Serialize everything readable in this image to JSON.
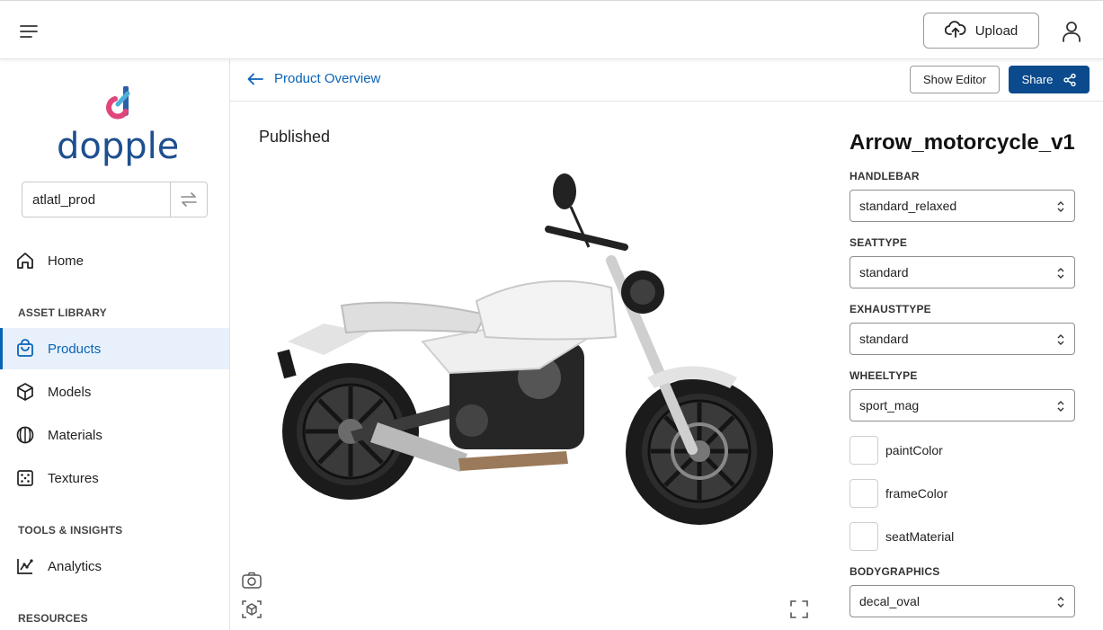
{
  "topbar": {
    "upload_label": "Upload"
  },
  "sidebar": {
    "logo_text": "dopple",
    "workspace": "atlatl_prod",
    "home": "Home",
    "section_asset_library": "ASSET LIBRARY",
    "products": "Products",
    "models": "Models",
    "materials": "Materials",
    "textures": "Textures",
    "section_tools": "TOOLS & INSIGHTS",
    "analytics": "Analytics",
    "section_resources": "RESOURCES"
  },
  "subheader": {
    "back_label": "Product Overview",
    "show_editor_label": "Show Editor",
    "share_label": "Share"
  },
  "viewer": {
    "status": "Published"
  },
  "config": {
    "title": "Arrow_motorcycle_v1",
    "options": [
      {
        "label": "HANDLEBAR",
        "value": "standard_relaxed"
      },
      {
        "label": "SEATTYPE",
        "value": "standard"
      },
      {
        "label": "EXHAUSTTYPE",
        "value": "standard"
      },
      {
        "label": "WHEELTYPE",
        "value": "sport_mag"
      }
    ],
    "swatches": [
      "paintColor",
      "frameColor",
      "seatMaterial"
    ],
    "bodygraphics": {
      "label": "BODYGRAPHICS",
      "value": "decal_oval"
    }
  },
  "colors": {
    "accent": "#0b63b6",
    "share_bg": "#0b4a8c",
    "active_bg": "#e8f1fb"
  }
}
